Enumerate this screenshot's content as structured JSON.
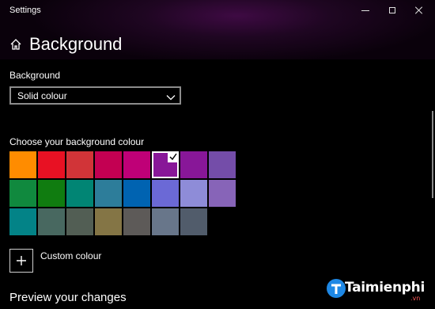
{
  "window": {
    "title": "Settings"
  },
  "header": {
    "title": "Background",
    "icon": "home-icon"
  },
  "background_setting": {
    "label": "Background",
    "selected_value": "Solid colour"
  },
  "colour_picker": {
    "label": "Choose your background colour",
    "selected_colour": "#881798",
    "rows": [
      [
        "#ff8c00",
        "#e81123",
        "#d13438",
        "#c30052",
        "#bf0077",
        "#881798",
        "#881798",
        "#744da9"
      ],
      [
        "#10893e",
        "#107c10",
        "#018574",
        "#2d7d9a",
        "#0063b1",
        "#6b69d6",
        "#8e8cd8",
        "#8764b8"
      ],
      [
        "#038387",
        "#486860",
        "#525e54",
        "#847545",
        "#5d5a58",
        "#68768a",
        "#515c6b"
      ]
    ]
  },
  "custom_colour": {
    "label": "Custom colour"
  },
  "preview": {
    "title": "Preview your changes"
  },
  "watermark": {
    "brand": "Taimienphi",
    "suffix": ".vn"
  },
  "colors": {
    "accent": "#881798",
    "background": "#000000",
    "text": "#ffffff"
  }
}
